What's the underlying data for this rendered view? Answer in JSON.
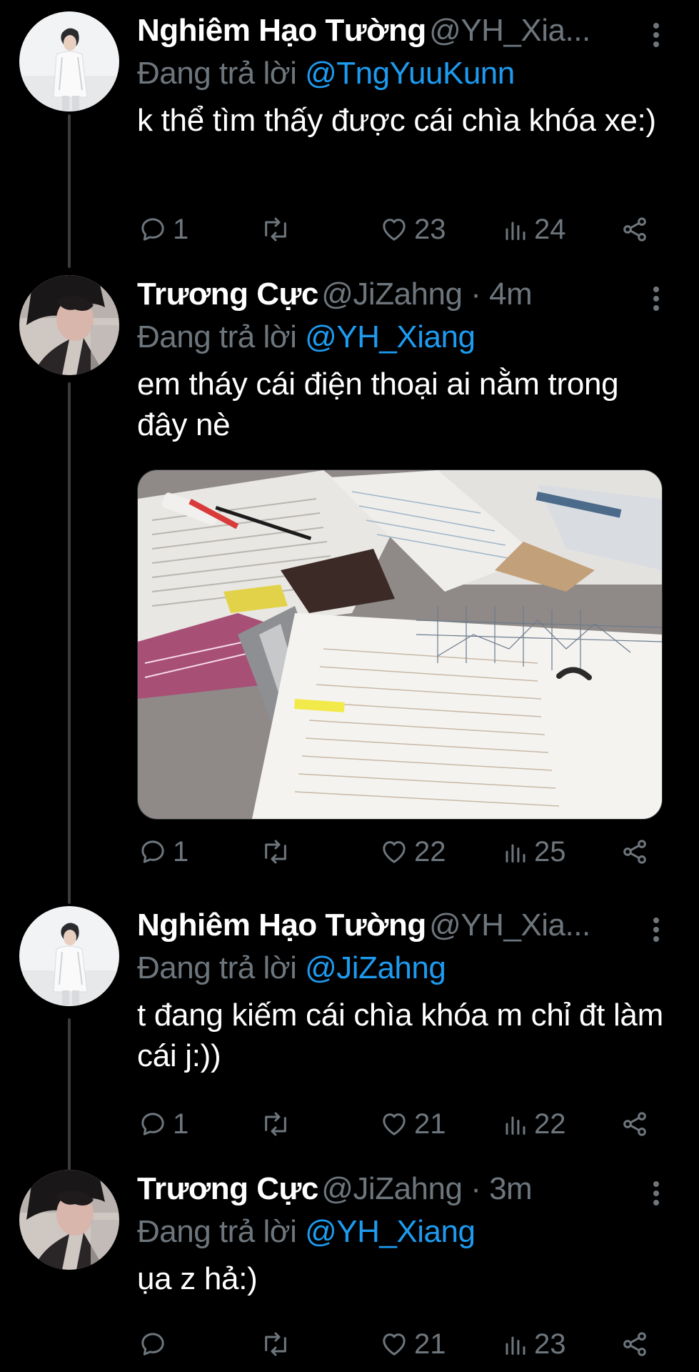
{
  "colors": {
    "background": "#000000",
    "primary_text": "#ffffff",
    "secondary_text": "#6e767d",
    "link": "#1d9bf0",
    "thread_line": "#3a3c3f"
  },
  "tweets": [
    {
      "display_name": "Nghiêm Hạo Tường",
      "handle_meta": "@YH_Xia...",
      "reply_prefix": "Đang trả lời ",
      "reply_handle": "@TngYuuKunn",
      "text": "k thể tìm thấy được cái chìa khóa xe:)",
      "avatar_icon": "avatar-white-shirt-photo",
      "actions": {
        "reply": "1",
        "retweet": "",
        "like": "23",
        "views": "24"
      }
    },
    {
      "display_name": "Trương Cực",
      "handle_meta": "@JiZahng · 4m",
      "reply_prefix": "Đang trả lời ",
      "reply_handle": "@YH_Xiang",
      "text": "em tháy cái điện thoại ai nằm trong đây nè",
      "avatar_icon": "avatar-dark-hair-photo",
      "media_icon": "desk-papers-photo",
      "actions": {
        "reply": "1",
        "retweet": "",
        "like": "22",
        "views": "25"
      }
    },
    {
      "display_name": "Nghiêm Hạo Tường",
      "handle_meta": "@YH_Xia...",
      "reply_prefix": "Đang trả lời ",
      "reply_handle": "@JiZahng",
      "text": "t đang kiếm cái chìa khóa m chỉ đt làm cái j:))",
      "avatar_icon": "avatar-white-shirt-photo",
      "actions": {
        "reply": "1",
        "retweet": "",
        "like": "21",
        "views": "22"
      }
    },
    {
      "display_name": "Trương Cực",
      "handle_meta": "@JiZahng · 3m",
      "reply_prefix": "Đang trả lời ",
      "reply_handle": "@YH_Xiang",
      "text": "ụa z hả:)",
      "avatar_icon": "avatar-dark-hair-photo",
      "actions": {
        "reply": "",
        "retweet": "",
        "like": "21",
        "views": "23"
      }
    }
  ]
}
